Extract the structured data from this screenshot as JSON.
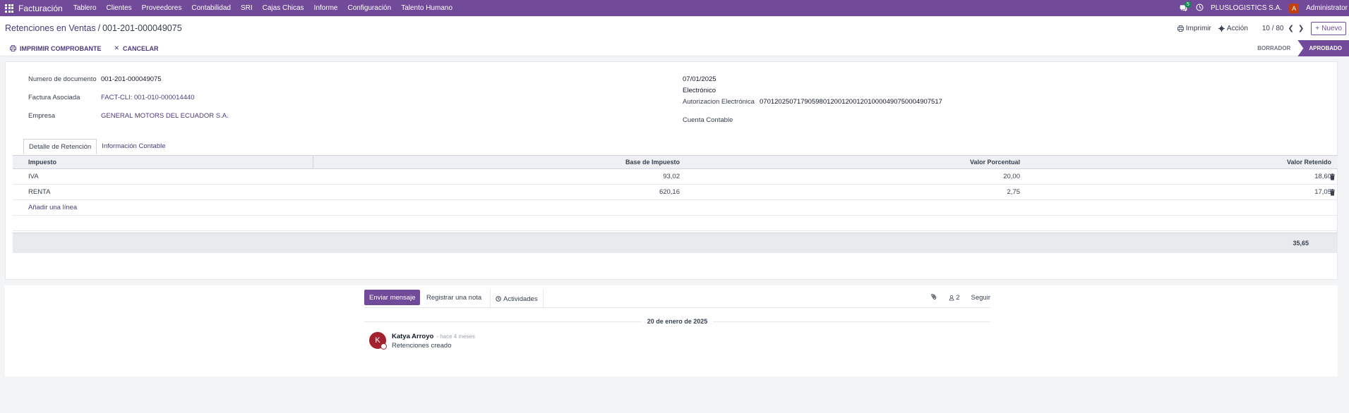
{
  "navbar": {
    "app_title": "Facturación",
    "menu": [
      "Tablero",
      "Clientes",
      "Proveedores",
      "Contabilidad",
      "SRI",
      "Cajas Chicas",
      "Informe",
      "Configuración",
      "Talento Humano"
    ],
    "chat_count": "5",
    "company": "PLUSLOGISTICS S.A.",
    "user_initial": "A",
    "user_name": "Administrator",
    "bg_color": "#714b9a"
  },
  "control": {
    "breadcrumb_parent": "Retenciones en Ventas",
    "breadcrumb_sep": "/",
    "breadcrumb_current": "001-201-000049075",
    "print_label": "Imprimir",
    "action_label": "Acción",
    "pager": "10 / 80",
    "new_label": "Nuevo"
  },
  "statusbar": {
    "print_voucher": "IMPRIMIR COMPROBANTE",
    "cancel": "CANCELAR",
    "stages": [
      "BORRADOR",
      "APROBADO"
    ],
    "active_stage": "APROBADO"
  },
  "form": {
    "doc_number_label": "Numero de documento",
    "doc_number": "001-201-000049075",
    "invoice_label": "Factura Asociada",
    "invoice": "FACT-CLI: 001-010-000014440",
    "company_label": "Empresa",
    "company": "GENERAL MOTORS DEL ECUADOR S.A.",
    "date": "07/01/2025",
    "emission_type": "Electrónico",
    "auth_label": "Autorizacion Electrónica",
    "auth": "0701202507179059801200120012010000490750004907517",
    "account_label": "Cuenta Contable"
  },
  "tabs": [
    "Detalle de Retención",
    "Información Contable"
  ],
  "table": {
    "headers": [
      "Impuesto",
      "Base de Impuesto",
      "Valor Porcentual",
      "Valor Retenido"
    ],
    "rows": [
      {
        "tax": "IVA",
        "base": "93,02",
        "pct": "20,00",
        "withheld": "18,60"
      },
      {
        "tax": "RENTA",
        "base": "620,16",
        "pct": "2,75",
        "withheld": "17,05"
      }
    ],
    "add_line": "Añadir una línea",
    "total": "35,65"
  },
  "chatter": {
    "send_message": "Enviar mensaje",
    "log_note": "Registrar una nota",
    "activities": "Actividades",
    "followers": "2",
    "follow": "Seguir",
    "date_separator": "20 de enero de 2025",
    "message": {
      "avatar_initial": "K",
      "author": "Katya Arroyo",
      "time": "- hace 4 meses",
      "body": "Retenciones creado"
    }
  }
}
